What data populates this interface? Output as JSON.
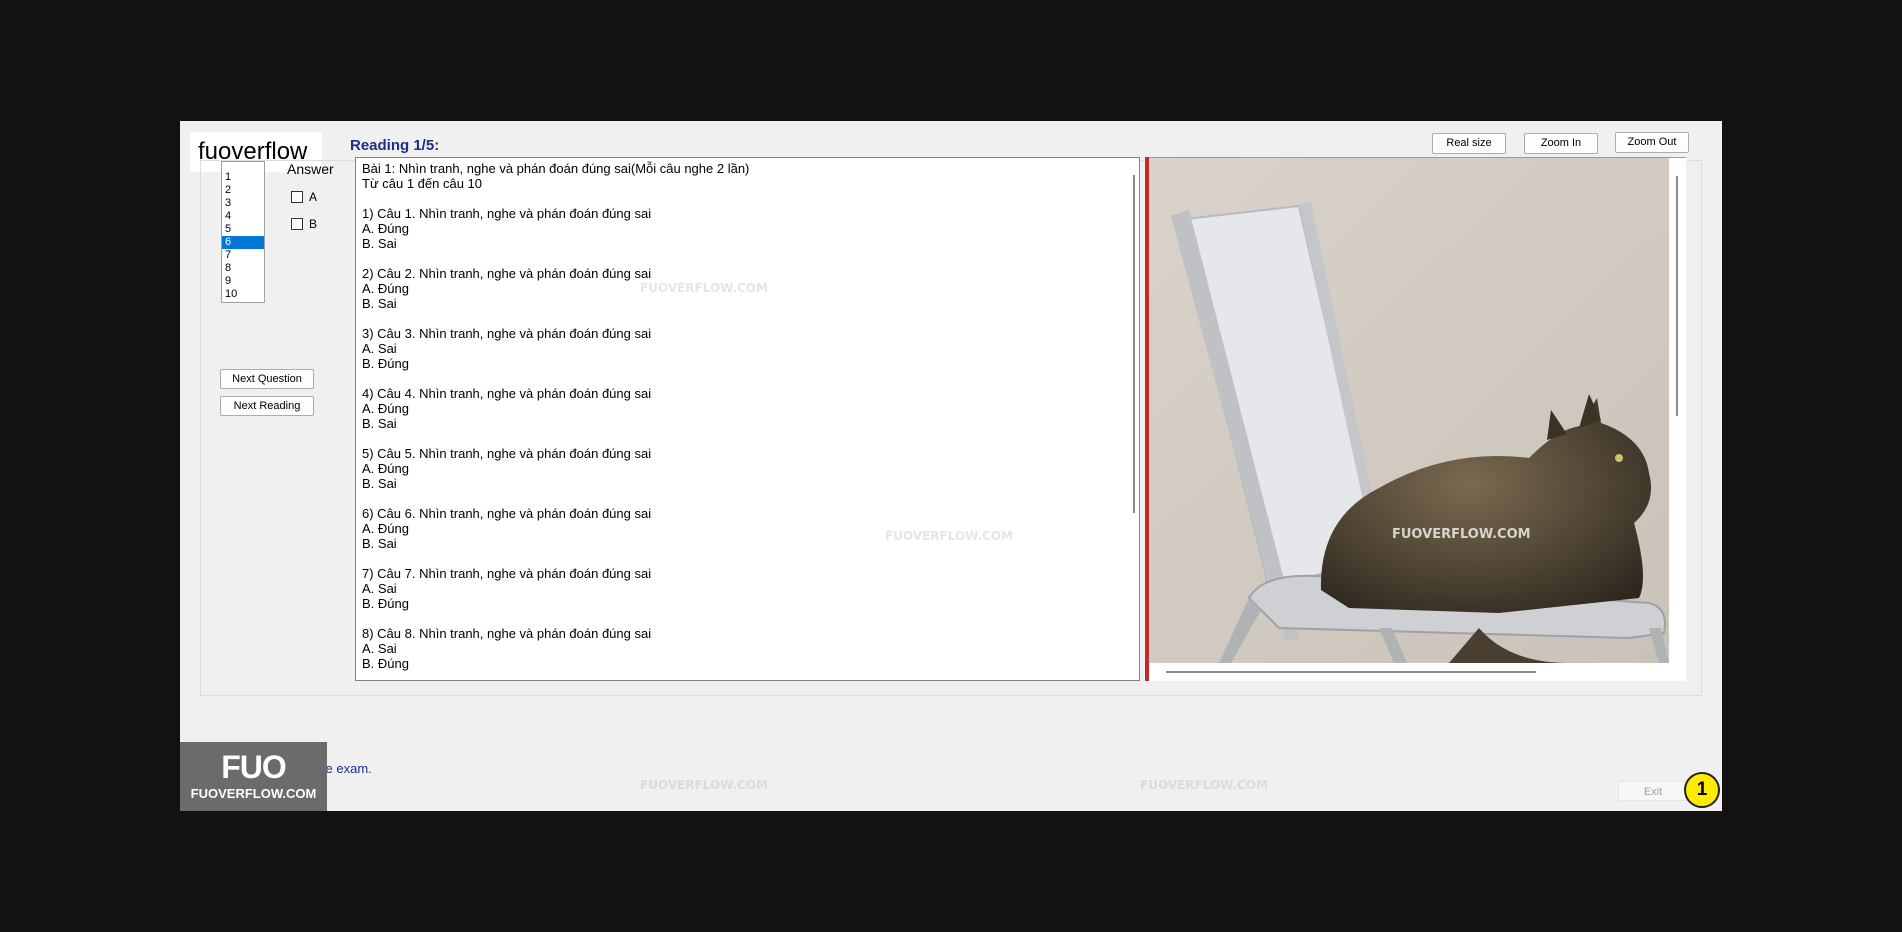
{
  "brand": {
    "text": "fuoverflow"
  },
  "question_list": {
    "items": [
      "1",
      "2",
      "3",
      "4",
      "5",
      "6",
      "7",
      "8",
      "9",
      "10"
    ],
    "selected": "6"
  },
  "answer": {
    "label": "Answer",
    "options": [
      "A",
      "B"
    ]
  },
  "buttons": {
    "next_question": "Next Question",
    "next_reading": "Next Reading",
    "real_size": "Real size",
    "zoom_in": "Zoom In",
    "zoom_out": "Zoom Out",
    "exit": "Exit"
  },
  "reading_title": "Reading 1/5:",
  "content": {
    "lines": [
      "Bài 1: Nhìn tranh, nghe và phán đoán đúng sai(Mỗi câu nghe 2 lần)",
      "Từ câu 1 đến câu 10",
      "",
      "1) Câu 1. Nhìn tranh, nghe và phán đoán đúng sai",
      "A. Đúng",
      "B. Sai",
      "",
      "2) Câu 2. Nhìn tranh, nghe và phán đoán đúng sai",
      "A. Đúng",
      "B. Sai",
      "",
      "3) Câu 3. Nhìn tranh, nghe và phán đoán đúng sai",
      "A. Sai",
      "B. Đúng",
      "",
      "4) Câu 4. Nhìn tranh, nghe và phán đoán đúng sai",
      "A. Đúng",
      "B. Sai",
      "",
      "5) Câu 5. Nhìn tranh, nghe và phán đoán đúng sai",
      "A. Đúng",
      "B. Sai",
      "",
      "6) Câu 6. Nhìn tranh, nghe và phán đoán đúng sai",
      "A. Đúng",
      "B. Sai",
      "",
      "7) Câu 7. Nhìn tranh, nghe và phán đoán đúng sai",
      "A. Sai",
      "B. Đúng",
      "",
      "8) Câu 8. Nhìn tranh, nghe và phán đoán đúng sai",
      "A. Sai",
      "B. Đúng"
    ]
  },
  "image_watermark": "FUOVERFLOW.COM",
  "finish_label": "I want to finish the exam.",
  "logo": {
    "big": "FUO",
    "small": "FUOVERFLOW.COM"
  },
  "badge": "1",
  "colors": {
    "accent_title": "#1c2e8c",
    "splitter": "#c62828",
    "selection": "#0078d7",
    "badge": "#ffeb00"
  }
}
